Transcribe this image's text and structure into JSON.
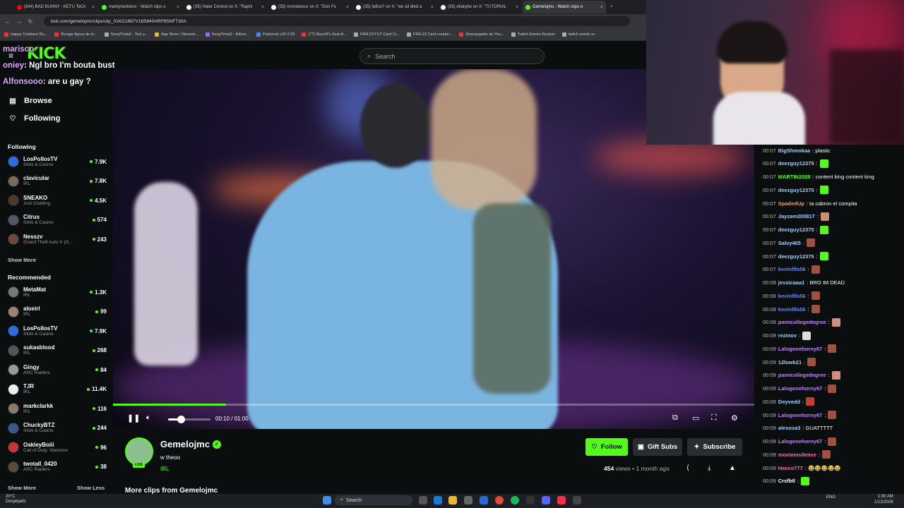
{
  "browser": {
    "tabs": [
      {
        "label": "(644) BAD BUNNY - KETU TeCh",
        "color": "#ff0000"
      },
      {
        "label": "markynextdoor - Watch clips o",
        "color": "#53fc18"
      },
      {
        "label": "(35) Hater Central on X: \"Raphi",
        "color": "#ffffff"
      },
      {
        "label": "(35) morodetsur on X: \"Don Fe",
        "color": "#ffffff"
      },
      {
        "label": "(35) fatfso? on X: \"we all died a",
        "color": "#ffffff"
      },
      {
        "label": "(35) eitakylie on X: \"TUTORIAL",
        "color": "#ffffff"
      },
      {
        "label": "Gemelojmc - Watch clips o",
        "color": "#53fc18"
      }
    ],
    "url": "kick.com/gemelojmc/clips/clip_01KG1867V18S840ARP9SNFT30A",
    "bookmarks": [
      "Happy Cristiano Ro...",
      "Burago figura de to...",
      "SongTrivia2 - Test y...",
      "App Store / Streami...",
      "SongTrivia2 - Adivin...",
      "Paletools v26.0.28",
      "(77) Racc0f's Zest-A...",
      "FIFA 23 FUT Card Cr...",
      "FIFA 23 Card creator...",
      "Descargador de You...",
      "Twitch Emote Resizer",
      "twitch emote re"
    ]
  },
  "kick": {
    "logo": "KICK",
    "search_placeholder": "Search",
    "nav": {
      "browse": "Browse",
      "following": "Following"
    },
    "following_header": "Following",
    "following": [
      {
        "name": "LosPollosTV",
        "category": "Slots & Casino",
        "viewers": "7.9K",
        "color": "#2d6cdf"
      },
      {
        "name": "clavicular",
        "category": "IRL",
        "viewers": "7.8K",
        "color": "#7a6a5a"
      },
      {
        "name": "SNEAKO",
        "category": "Just Chatting",
        "viewers": "4.5K",
        "color": "#4a3a2a"
      },
      {
        "name": "Citrus",
        "category": "Slots & Casino",
        "viewers": "574",
        "color": "#556"
      },
      {
        "name": "Nesszv",
        "category": "Grand Theft Auto V (G...",
        "viewers": "243",
        "color": "#6b4a3a"
      }
    ],
    "show_more": "Show More",
    "recommended_header": "Recommended",
    "recommended": [
      {
        "name": "MetaMat",
        "category": "IRL",
        "viewers": "1.3K",
        "color": "#777"
      },
      {
        "name": "aloeirl",
        "category": "IRL",
        "viewers": "99",
        "color": "#a08070"
      },
      {
        "name": "LosPollosTV",
        "category": "Slots & Casino",
        "viewers": "7.9K",
        "color": "#2d6cdf"
      },
      {
        "name": "sukasblood",
        "category": "IRL",
        "viewers": "268",
        "color": "#555"
      },
      {
        "name": "Gingy",
        "category": "ARC Raiders",
        "viewers": "84",
        "color": "#999"
      },
      {
        "name": "TJR",
        "category": "IRL",
        "viewers": "11.4K",
        "color": "#eee"
      },
      {
        "name": "markclarkk",
        "category": "IRL",
        "viewers": "116",
        "color": "#8a7a6a"
      },
      {
        "name": "ChuckyBTZ",
        "category": "Slots & Casino",
        "viewers": "244",
        "color": "#3a5a8a"
      },
      {
        "name": "OakleyBoiii",
        "category": "Call of Duty: Warzone",
        "viewers": "96",
        "color": "#c33"
      },
      {
        "name": "twotall_0420",
        "category": "ARC Raiders",
        "viewers": "38",
        "color": "#5a4a3a"
      }
    ],
    "show_more_bottom": "Show More",
    "show_less": "Show Less"
  },
  "overlay_chat": [
    {
      "user": "marisco",
      "text": ""
    },
    {
      "user": "oniey",
      "text": ": Ngl bro I'm bouta bust"
    },
    {
      "user": "Alfonsooo",
      "text": ": are u gay ?"
    }
  ],
  "player": {
    "progress": 0.176,
    "volume": 0.3,
    "time": "00:10 / 01:00"
  },
  "clip": {
    "channel": "Gemelojmc",
    "live_badge": "LIVE",
    "title": "w theoo",
    "category": "IRL",
    "follow": "Follow",
    "gift": "Gift Subs",
    "subscribe": "Subscribe",
    "views": "454",
    "views_label": " views • 1 month ago",
    "more_clips": "More clips from Gemelojmc"
  },
  "chat": [
    {
      "time": "00:07",
      "user": "BigShmokaa",
      "text": ": plastic",
      "color": "#9ad0ff",
      "emote": ""
    },
    {
      "time": "00:07",
      "user": "deezguy12375",
      "text": ":",
      "color": "#9ad0ff",
      "emote": "#53fc18"
    },
    {
      "time": "00:07",
      "user": "MARTIN2020",
      "text": ": content king content king",
      "color": "#53fc18",
      "emote": ""
    },
    {
      "time": "00:07",
      "user": "deezguy12375",
      "text": ":",
      "color": "#9ad0ff",
      "emote": "#53fc18"
    },
    {
      "time": "00:07",
      "user": "SpadedUp",
      "text": ": ta cabron el compita",
      "color": "#f0a040",
      "emote": ""
    },
    {
      "time": "00:07",
      "user": "Jayzam200817",
      "text": ":",
      "color": "#9ad0ff",
      "emote": "#c89070"
    },
    {
      "time": "00:07",
      "user": "deezguy12375",
      "text": ":",
      "color": "#9ad0ff",
      "emote": "#53fc18"
    },
    {
      "time": "00:07",
      "user": "Salvy405",
      "text": ":",
      "color": "#9ad0ff",
      "emote": "#a05040"
    },
    {
      "time": "00:07",
      "user": "deezguy12375",
      "text": ":",
      "color": "#9ad0ff",
      "emote": "#53fc18"
    },
    {
      "time": "00:07",
      "user": "kevinfifa56",
      "text": ":",
      "color": "#5a8aff",
      "emote": "#a05040"
    },
    {
      "time": "00:08",
      "user": "jessicaaa1",
      "text": ": BRO IM DEAD",
      "color": "#9ad0ff",
      "emote": ""
    },
    {
      "time": "00:08",
      "user": "kevinfifa56",
      "text": ":",
      "color": "#5a8aff",
      "emote": "#a05040"
    },
    {
      "time": "00:08",
      "user": "kevinfifa56",
      "text": ":",
      "color": "#5a8aff",
      "emote": "#a05040"
    },
    {
      "time": "00:09",
      "user": "pamicollegedegree",
      "text": ":",
      "color": "#c080ff",
      "emote": "#d09080"
    },
    {
      "time": "00:09",
      "user": "rezinov",
      "text": ":",
      "color": "#9ad0ff",
      "emote": "#dddddd"
    },
    {
      "time": "00:09",
      "user": "Lalogonehorny67",
      "text": ":",
      "color": "#c080ff",
      "emote": "#a05040"
    },
    {
      "time": "00:09",
      "user": "12lowk21",
      "text": ":",
      "color": "#9ad0ff",
      "emote": "#a05040"
    },
    {
      "time": "00:09",
      "user": "pamicollegedegree",
      "text": ":",
      "color": "#c080ff",
      "emote": "#d09080"
    },
    {
      "time": "00:09",
      "user": "Lalogonehorny67",
      "text": ":",
      "color": "#c080ff",
      "emote": "#a05040"
    },
    {
      "time": "00:09",
      "user": "Deyvedd",
      "text": ":",
      "color": "#9ad0ff",
      "emote": "#c04030"
    },
    {
      "time": "00:09",
      "user": "Lalogonehorny67",
      "text": ":",
      "color": "#c080ff",
      "emote": "#a05040"
    },
    {
      "time": "00:09",
      "user": "alesosa3",
      "text": ": GUATTTTT",
      "color": "#9ad0ff",
      "emote": ""
    },
    {
      "time": "00:09",
      "user": "Lalogonehorny67",
      "text": ":",
      "color": "#c080ff",
      "emote": "#a05040"
    },
    {
      "time": "00:09",
      "user": "movininsilence",
      "text": ":",
      "color": "#ff70b0",
      "emote": "#a05040"
    },
    {
      "time": "00:09",
      "user": "Hecco777",
      "text": ": 😂😂😂😂😂",
      "color": "#ff70b0",
      "emote": ""
    },
    {
      "time": "00:09",
      "user": "Crsfbtl",
      "text": ":",
      "color": "#ffffff",
      "emote": "#53fc18"
    }
  ],
  "taskbar": {
    "temp": "20°C",
    "weather": "Despejado",
    "search": "Search",
    "lang": "ENG",
    "time": "1:00 AM",
    "date": "1/12/2026"
  }
}
